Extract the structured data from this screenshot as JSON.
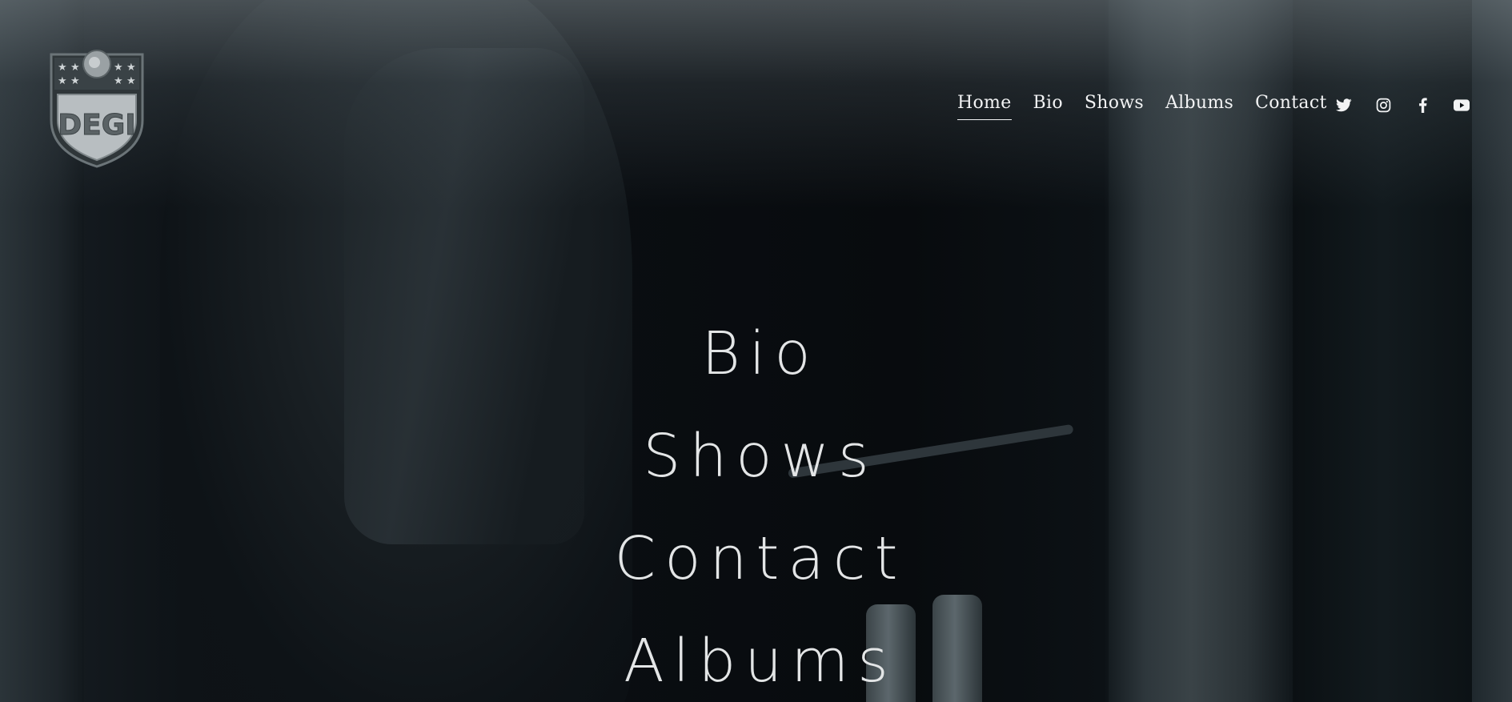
{
  "site": {
    "logo_text": "DEGI",
    "logo_icon": "shield-badge-logo"
  },
  "nav": {
    "items": [
      {
        "label": "Home",
        "active": true
      },
      {
        "label": "Bio",
        "active": false
      },
      {
        "label": "Shows",
        "active": false
      },
      {
        "label": "Albums",
        "active": false
      },
      {
        "label": "Contact",
        "active": false
      }
    ]
  },
  "social": [
    {
      "icon": "twitter-icon"
    },
    {
      "icon": "instagram-icon"
    },
    {
      "icon": "facebook-icon"
    },
    {
      "icon": "youtube-icon"
    }
  ],
  "center_menu": {
    "items": [
      "Bio",
      "Shows",
      "Contact",
      "Albums"
    ]
  }
}
